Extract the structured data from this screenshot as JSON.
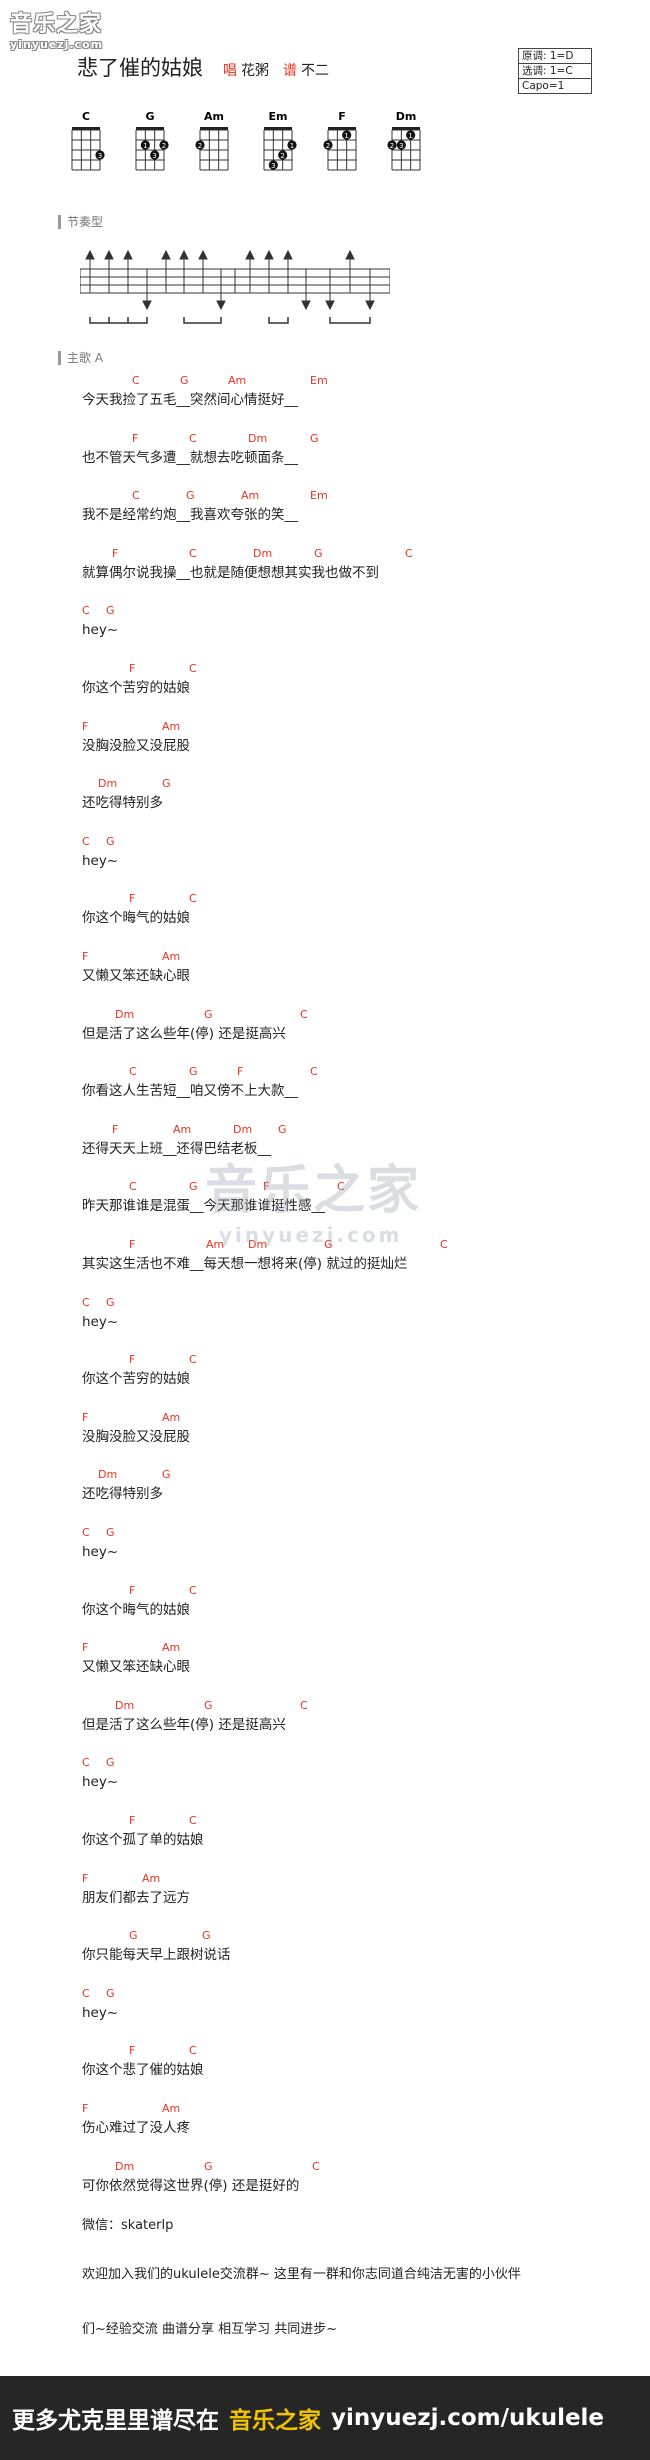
{
  "logo": {
    "main": "音乐之家",
    "sub": "yinyuezj.com"
  },
  "song": {
    "title": "悲了催的姑娘",
    "singer_label": "唱",
    "singer": "花粥",
    "arranger_label": "谱",
    "arranger": "不二"
  },
  "info": {
    "original_key": "原调: 1=D",
    "play_key": "选调: 1=C",
    "capo": "Capo=1"
  },
  "chords": [
    {
      "name": "C",
      "dots": [
        {
          "s": 3,
          "f": 3,
          "n": "3"
        }
      ]
    },
    {
      "name": "G",
      "dots": [
        {
          "s": 1,
          "f": 2,
          "n": "1"
        },
        {
          "s": 3,
          "f": 2,
          "n": "2"
        },
        {
          "s": 2,
          "f": 3,
          "n": "3"
        }
      ]
    },
    {
      "name": "Am",
      "dots": [
        {
          "s": 0,
          "f": 2,
          "n": "2"
        }
      ]
    },
    {
      "name": "Em",
      "dots": [
        {
          "s": 3,
          "f": 2,
          "n": "1"
        },
        {
          "s": 2,
          "f": 3,
          "n": "2"
        },
        {
          "s": 1,
          "f": 4,
          "n": "3"
        }
      ]
    },
    {
      "name": "F",
      "dots": [
        {
          "s": 2,
          "f": 1,
          "n": "1"
        },
        {
          "s": 0,
          "f": 2,
          "n": "2"
        }
      ]
    },
    {
      "name": "Dm",
      "dots": [
        {
          "s": 2,
          "f": 1,
          "n": "1"
        },
        {
          "s": 0,
          "f": 2,
          "n": "2"
        },
        {
          "s": 1,
          "f": 2,
          "n": "3"
        }
      ]
    }
  ],
  "sections": {
    "rhythm": "节奏型",
    "verse": "主歌 A"
  },
  "lyrics": [
    {
      "chords": [
        [
          "C",
          50
        ],
        [
          "G",
          98
        ],
        [
          "Am",
          146
        ],
        [
          "Em",
          228
        ]
      ],
      "text": "今天我捡了五毛__突然间心情挺好__"
    },
    {
      "chords": [
        [
          "F",
          50
        ],
        [
          "C",
          107
        ],
        [
          "Dm",
          166
        ],
        [
          "G",
          228
        ]
      ],
      "text": "也不管天气多遭__就想去吃顿面条__"
    },
    {
      "chords": [
        [
          "C",
          50
        ],
        [
          "G",
          104
        ],
        [
          "Am",
          159
        ],
        [
          "Em",
          228
        ]
      ],
      "text": "我不是经常约炮__我喜欢夸张的笑__"
    },
    {
      "chords": [
        [
          "F",
          30
        ],
        [
          "C",
          107
        ],
        [
          "Dm",
          171
        ],
        [
          "G",
          232
        ],
        [
          "C",
          323
        ]
      ],
      "text": "就算偶尔说我操__也就是随便想想其实我也做不到"
    },
    {
      "chords": [
        [
          "C",
          0
        ],
        [
          "G",
          24
        ]
      ],
      "text": "hey~"
    },
    {
      "chords": [
        [
          "F",
          47
        ],
        [
          "C",
          107
        ]
      ],
      "text": "你这个苦穷的姑娘"
    },
    {
      "chords": [
        [
          "F",
          0
        ],
        [
          "Am",
          80
        ]
      ],
      "text": "没胸没脸又没屁股"
    },
    {
      "chords": [
        [
          "Dm",
          16
        ],
        [
          "G",
          80
        ]
      ],
      "text": "还吃得特别多"
    },
    {
      "chords": [
        [
          "C",
          0
        ],
        [
          "G",
          24
        ]
      ],
      "text": "hey~"
    },
    {
      "chords": [
        [
          "F",
          47
        ],
        [
          "C",
          107
        ]
      ],
      "text": "你这个晦气的姑娘"
    },
    {
      "chords": [
        [
          "F",
          0
        ],
        [
          "Am",
          80
        ]
      ],
      "text": "又懒又笨还缺心眼"
    },
    {
      "chords": [
        [
          "Dm",
          33
        ],
        [
          "G",
          122
        ],
        [
          "C",
          218
        ]
      ],
      "text": "但是活了这么些年(停)  还是挺高兴"
    },
    {
      "chords": [
        [
          "C",
          47
        ],
        [
          "G",
          107
        ],
        [
          "F",
          155
        ],
        [
          "C",
          228
        ]
      ],
      "text": "你看这人生苦短__咱又傍不上大款__"
    },
    {
      "chords": [
        [
          "F",
          30
        ],
        [
          "Am",
          91
        ],
        [
          "Dm",
          151
        ],
        [
          "G",
          196
        ]
      ],
      "text": "还得天天上班__还得巴结老板__"
    },
    {
      "chords": [
        [
          "C",
          47
        ],
        [
          "G",
          107
        ],
        [
          "F",
          181
        ],
        [
          "C",
          255
        ]
      ],
      "text": "昨天那谁谁是混蛋__今天那谁谁挺性感__"
    },
    {
      "chords": [
        [
          "F",
          47
        ],
        [
          "Am",
          124
        ],
        [
          "Dm",
          166
        ],
        [
          "G",
          242
        ],
        [
          "C",
          358
        ]
      ],
      "text": "其实这生活也不难__每天想一想将来(停)  就过的挺灿烂"
    },
    {
      "chords": [
        [
          "C",
          0
        ],
        [
          "G",
          24
        ]
      ],
      "text": "hey~"
    },
    {
      "chords": [
        [
          "F",
          47
        ],
        [
          "C",
          107
        ]
      ],
      "text": "你这个苦穷的姑娘"
    },
    {
      "chords": [
        [
          "F",
          0
        ],
        [
          "Am",
          80
        ]
      ],
      "text": "没胸没脸又没屁股"
    },
    {
      "chords": [
        [
          "Dm",
          16
        ],
        [
          "G",
          80
        ]
      ],
      "text": "还吃得特别多"
    },
    {
      "chords": [
        [
          "C",
          0
        ],
        [
          "G",
          24
        ]
      ],
      "text": "hey~"
    },
    {
      "chords": [
        [
          "F",
          47
        ],
        [
          "C",
          107
        ]
      ],
      "text": "你这个晦气的姑娘"
    },
    {
      "chords": [
        [
          "F",
          0
        ],
        [
          "Am",
          80
        ]
      ],
      "text": "又懒又笨还缺心眼"
    },
    {
      "chords": [
        [
          "Dm",
          33
        ],
        [
          "G",
          122
        ],
        [
          "C",
          218
        ]
      ],
      "text": "但是活了这么些年(停)  还是挺高兴"
    },
    {
      "chords": [
        [
          "C",
          0
        ],
        [
          "G",
          24
        ]
      ],
      "text": "hey~"
    },
    {
      "chords": [
        [
          "F",
          47
        ],
        [
          "C",
          107
        ]
      ],
      "text": "你这个孤了单的姑娘"
    },
    {
      "chords": [
        [
          "F",
          0
        ],
        [
          "Am",
          60
        ]
      ],
      "text": "朋友们都去了远方"
    },
    {
      "chords": [
        [
          "G",
          47
        ],
        [
          "G",
          120
        ]
      ],
      "text": "你只能每天早上跟树说话"
    },
    {
      "chords": [
        [
          "C",
          0
        ],
        [
          "G",
          24
        ]
      ],
      "text": "hey~"
    },
    {
      "chords": [
        [
          "F",
          47
        ],
        [
          "C",
          107
        ]
      ],
      "text": "你这个悲了催的姑娘"
    },
    {
      "chords": [
        [
          "F",
          0
        ],
        [
          "Am",
          80
        ]
      ],
      "text": "伤心难过了没人疼"
    },
    {
      "chords": [
        [
          "Dm",
          33
        ],
        [
          "G",
          122
        ],
        [
          "C",
          230
        ]
      ],
      "text": "可你依然觉得这世界(停) 还是挺好的"
    }
  ],
  "contact": {
    "wechat": "微信：skaterlp",
    "group_line1": "欢迎加入我们的ukulele交流群~ 这里有一群和你志同道合纯洁无害的小伙伴",
    "group_line2": "们~经验交流 曲谱分享 相互学习 共同进步~"
  },
  "watermark": {
    "main": "音乐之家",
    "sub": "yinyuezj.com"
  },
  "footer": {
    "text": "更多尤克里里谱尽在",
    "brand": "音乐之家",
    "url": "yinyuezj.com/ukulele"
  },
  "colors": {
    "accent": "#e8321e",
    "footer_bg": "#262626",
    "footer_brand": "#f2c400"
  }
}
